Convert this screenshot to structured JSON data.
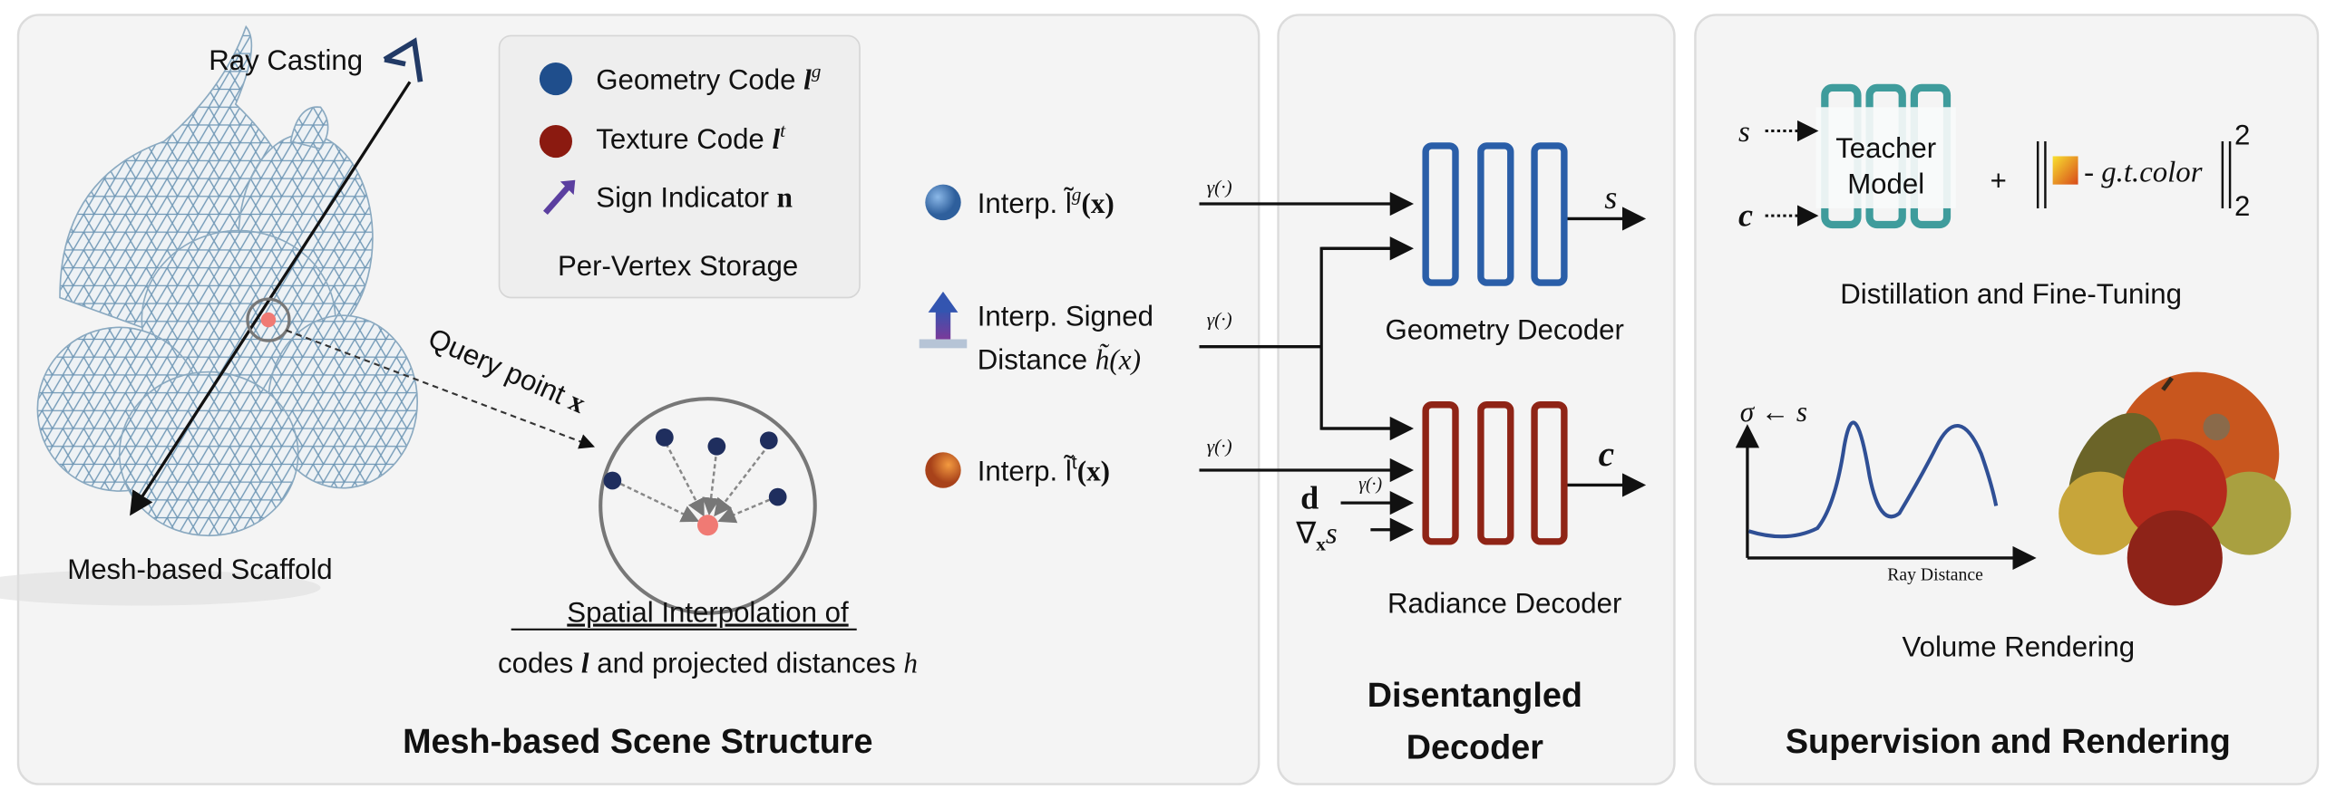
{
  "panels": {
    "structure": {
      "title": "Mesh-based Scene Structure",
      "ray_casting": "Ray Casting",
      "query_point": "Query point",
      "query_symbol": "x",
      "scaffold": "Mesh-based Scaffold",
      "interp_line1": "Spatial Interpolation of",
      "interp_line2a": "codes",
      "interp_line2_l": "l",
      "interp_line2b": "and projected distances",
      "interp_line2_h": "h",
      "legend": {
        "geometry": "Geometry Code",
        "geometry_sym": "l",
        "geometry_sup": "g",
        "texture": "Texture Code",
        "texture_sym": "l",
        "texture_sup": "t",
        "sign": "Sign Indicator",
        "sign_sym": "n",
        "caption": "Per-Vertex Storage"
      },
      "interp_geo": "Interp. l̃",
      "interp_geo_sup": "g",
      "interp_geo_arg": "(x)",
      "interp_signed_1": "Interp. Signed",
      "interp_signed_2": "Distance",
      "interp_signed_sym": "h̃(x)",
      "interp_tex": "Interp. l̃",
      "interp_tex_sup": "t",
      "interp_tex_arg": "(x)",
      "gamma": "γ(·)"
    },
    "decoder": {
      "title_1": "Disentangled",
      "title_2": "Decoder",
      "geometry_decoder": "Geometry Decoder",
      "radiance_decoder": "Radiance Decoder",
      "out_s": "s",
      "out_c": "c",
      "in_d": "d",
      "in_grad": "∇",
      "in_grad_sub": "x",
      "in_grad_s": "s",
      "gamma": "γ(·)"
    },
    "supervision": {
      "title": "Supervision and Rendering",
      "teacher_1": "Teacher",
      "teacher_2": "Model",
      "in_s": "s",
      "in_c": "c",
      "plus": "+",
      "gt_color": "- g.t.color",
      "norm_sup": "2",
      "norm_sub": "2",
      "distill_caption": "Distillation and Fine-Tuning",
      "sigma_label": "σ ← s",
      "ray_distance": "Ray Distance",
      "volume_caption": "Volume Rendering"
    }
  },
  "colors": {
    "geometry": "#1f4e8c",
    "texture": "#8b1a10",
    "sign": "#5b3fa0",
    "geometry_decoder": "#2a5ea8",
    "radiance_decoder": "#8f2416",
    "teacher": "#3f9c9c",
    "panel_bg": "#f4f4f4",
    "query": "#f07a74"
  },
  "icons": [
    "eye-camera-icon",
    "sign-arrow-icon",
    "up-arrow-icon"
  ]
}
